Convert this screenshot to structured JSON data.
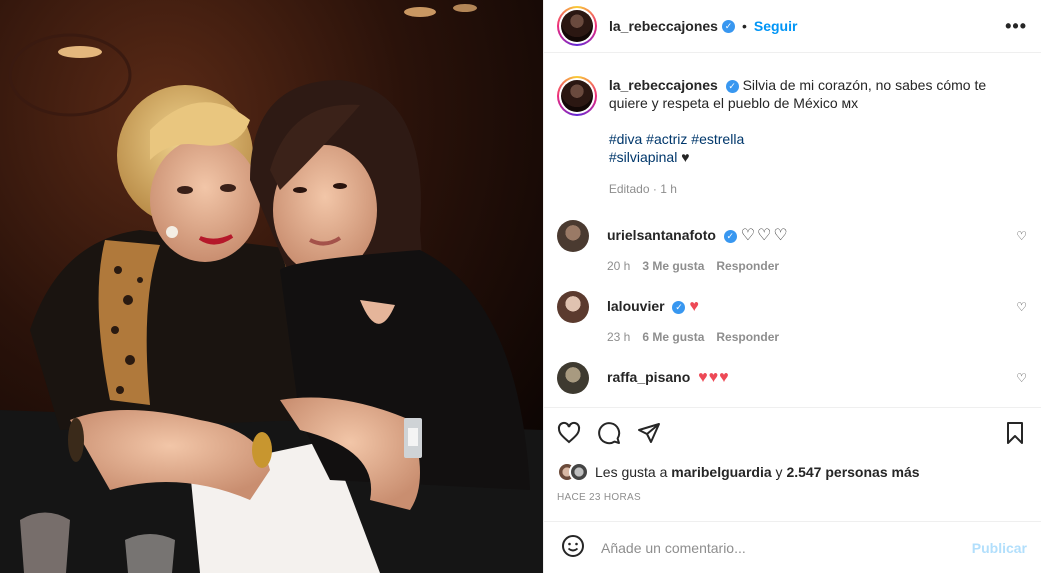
{
  "header": {
    "username": "la_rebeccajones",
    "follow_label": "Seguir",
    "separator": "•",
    "more_label": "•••"
  },
  "caption": {
    "username": "la_rebeccajones",
    "text": "Silvia de mi corazón, no sabes cómo te quiere y respeta el pueblo de México ᴍx",
    "hashtags_line1": "#diva #actriz #estrella",
    "hashtags_line2": "#silviapinal",
    "line2_suffix": "♥",
    "edited": "Editado · 1 h"
  },
  "comments": [
    {
      "username": "urielsantanafoto",
      "verified": true,
      "text": "♡♡♡",
      "time": "20 h",
      "likes": "3 Me gusta",
      "reply": "Responder"
    },
    {
      "username": "lalouvier",
      "verified": true,
      "text": "♥",
      "time": "23 h",
      "likes": "6 Me gusta",
      "reply": "Responder"
    },
    {
      "username": "raffa_pisano",
      "verified": false,
      "text": "♥♥♥",
      "time": "",
      "likes": "",
      "reply": ""
    }
  ],
  "icons": {
    "like": "heart-outline-icon",
    "comment": "comment-bubble-icon",
    "share": "paper-plane-icon",
    "save": "bookmark-icon",
    "emoji": "smiley-icon",
    "verified": "✓",
    "heart_small": "♡"
  },
  "likes": {
    "prefix": "Les gusta a ",
    "user": "maribelguardia",
    "mid": " y ",
    "count": "2.547 personas más"
  },
  "timestamp": "HACE 23 HORAS",
  "add_comment": {
    "placeholder": "Añade un comentario...",
    "post_label": "Publicar"
  },
  "colors": {
    "accent": "#0095f6",
    "heart_red": "#ed4956",
    "muted": "#8e8e8e"
  }
}
